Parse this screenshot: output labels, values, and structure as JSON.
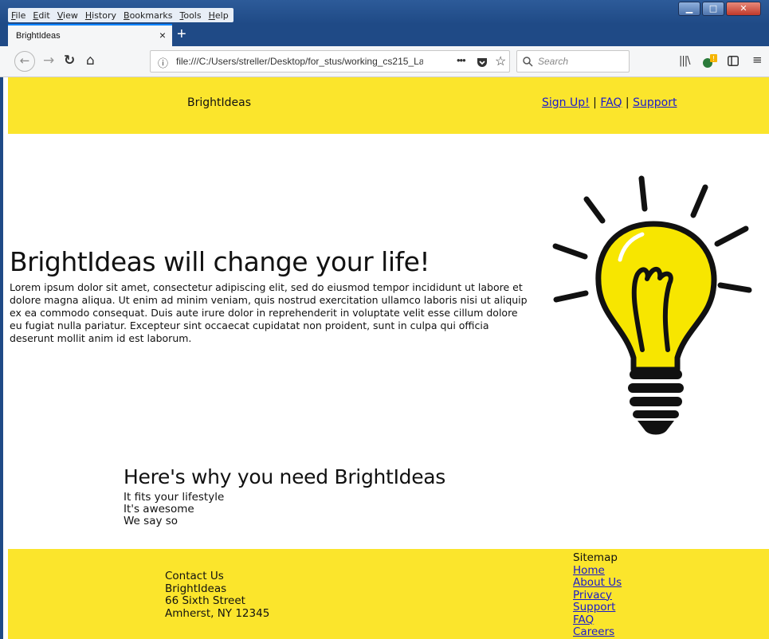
{
  "browser": {
    "menu": [
      "File",
      "Edit",
      "View",
      "History",
      "Bookmarks",
      "Tools",
      "Help"
    ],
    "window_controls": [
      "minimize",
      "maximize",
      "close"
    ],
    "tab": {
      "title": "BrightIdeas",
      "close": "×"
    },
    "new_tab": "+",
    "url": "file:///C:/Users/streller/Desktop/for_stus/working_cs215_La",
    "search_placeholder": "Search",
    "icons": [
      "back-arrow-icon",
      "forward-arrow-icon",
      "reload-icon",
      "home-icon",
      "info-icon",
      "page-actions-icon",
      "pocket-icon",
      "bookmark-star-icon",
      "search-icon",
      "library-icon",
      "extension-icon",
      "sidebar-icon",
      "hamburger-menu-icon"
    ]
  },
  "header": {
    "brand": "BrightIdeas",
    "links": [
      "Sign Up!",
      "FAQ",
      "Support"
    ],
    "separator": " | "
  },
  "hero": {
    "title": "BrightIdeas will change your life!",
    "text": "Lorem ipsum dolor sit amet, consectetur adipiscing elit, sed do eiusmod tempor incididunt ut labore et dolore magna aliqua. Ut enim ad minim veniam, quis nostrud exercitation ullamco laboris nisi ut aliquip ex ea commodo consequat. Duis aute irure dolor in reprehenderit in voluptate velit esse cillum dolore eu fugiat nulla pariatur. Excepteur sint occaecat cupidatat non proident, sunt in culpa qui officia deserunt mollit anim id est laborum.",
    "image": "lightbulb-illustration"
  },
  "why": {
    "title": "Here's why you need BrightIdeas",
    "items": [
      "It fits your lifestyle",
      "It's awesome",
      "We say so"
    ]
  },
  "footer": {
    "contact": [
      "Contact Us",
      "BrightIdeas",
      "66 Sixth Street",
      "Amherst, NY 12345"
    ],
    "sitemap_title": "Sitemap",
    "sitemap_links": [
      "Home",
      "About Us",
      "Privacy",
      "Support",
      "FAQ",
      "Careers"
    ]
  },
  "colors": {
    "accent_yellow": "#fbe52c",
    "link_blue": "#1a1acc",
    "titlebar_blue": "#1f4a86"
  }
}
